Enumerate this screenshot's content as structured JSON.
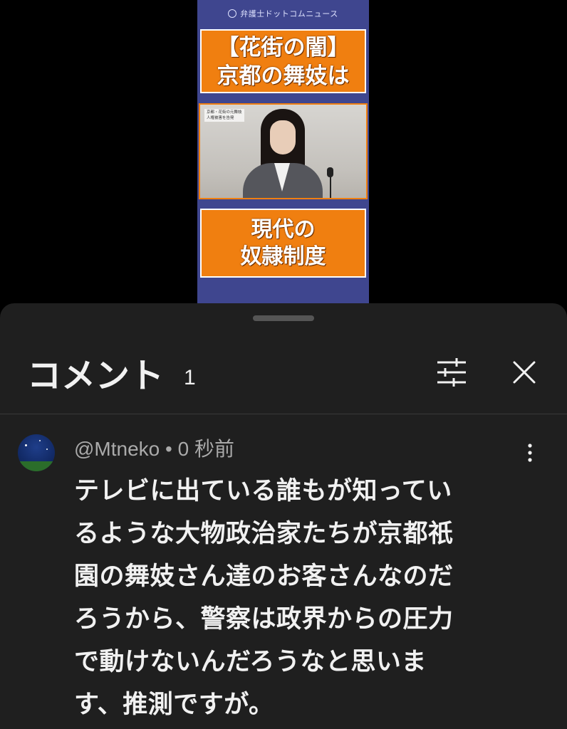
{
  "video": {
    "brand": "弁護士ドットコムニュース",
    "banner_top_line1": "【花街の闇】",
    "banner_top_line2": "京都の舞妓は",
    "photo_caption_line1": "京都・花街の元舞妓",
    "photo_caption_line2": "人権被害を告発",
    "banner_bottom_line1": "現代の",
    "banner_bottom_line2": "奴隷制度"
  },
  "comments_panel": {
    "title": "コメント",
    "count": "1",
    "icons": {
      "filter": "sliders-icon",
      "close": "close-icon",
      "more": "more-vert-icon"
    }
  },
  "comment": {
    "author": "@Mtneko",
    "separator": "•",
    "timestamp": "0 秒前",
    "text_lines": [
      "テレビに出ている誰もが知ってい",
      "るような大物政治家たちが京都祇",
      "園の舞妓さん達のお客さんなのだ",
      "ろうから、警察は政界からの圧力",
      "で動けないんだろうなと思いま",
      "す、推測ですが。"
    ]
  }
}
